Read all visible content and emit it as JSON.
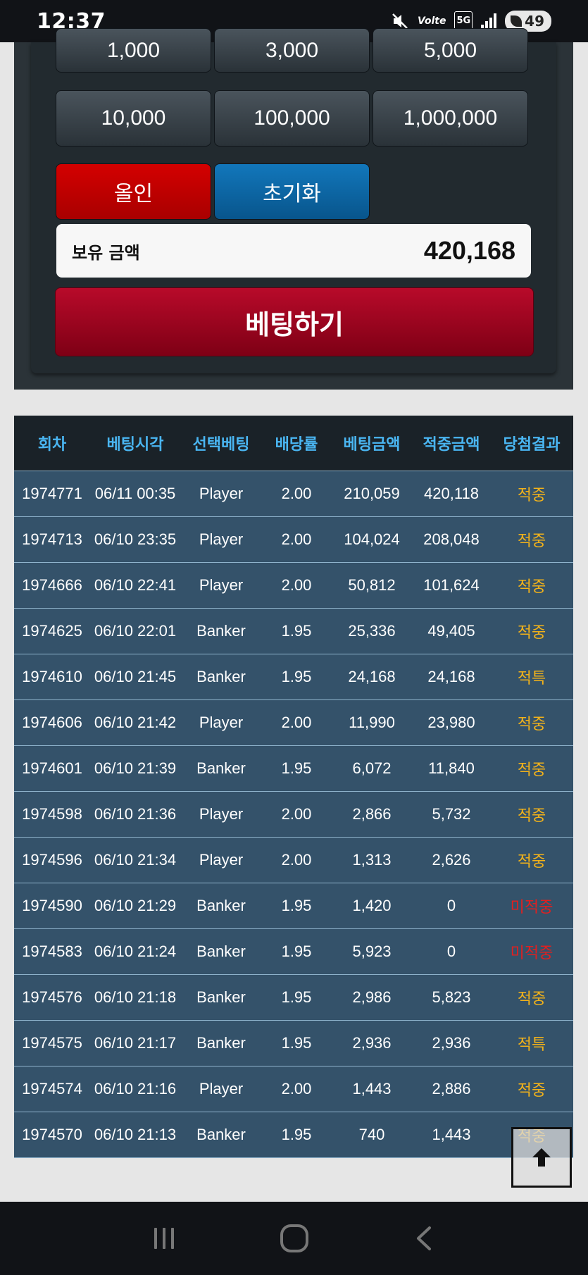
{
  "status_bar": {
    "time": "12:37",
    "battery": "49",
    "network": "5G",
    "volte": "Volte"
  },
  "amount_buttons": {
    "row1": [
      "1,000",
      "3,000",
      "5,000"
    ],
    "row2": [
      "10,000",
      "100,000",
      "1,000,000"
    ]
  },
  "actions": {
    "allin_label": "올인",
    "reset_label": "초기화"
  },
  "balance": {
    "label": "보유 금액",
    "value": "420,168"
  },
  "bet_button_label": "베팅하기",
  "history": {
    "columns": [
      "회차",
      "베팅시각",
      "선택베팅",
      "배당률",
      "베팅금액",
      "적중금액",
      "당첨결과"
    ],
    "rows": [
      [
        "1974771",
        "06/11 00:35",
        "Player",
        "2.00",
        "210,059",
        "420,118",
        "적중"
      ],
      [
        "1974713",
        "06/10 23:35",
        "Player",
        "2.00",
        "104,024",
        "208,048",
        "적중"
      ],
      [
        "1974666",
        "06/10 22:41",
        "Player",
        "2.00",
        "50,812",
        "101,624",
        "적중"
      ],
      [
        "1974625",
        "06/10 22:01",
        "Banker",
        "1.95",
        "25,336",
        "49,405",
        "적중"
      ],
      [
        "1974610",
        "06/10 21:45",
        "Banker",
        "1.95",
        "24,168",
        "24,168",
        "적특"
      ],
      [
        "1974606",
        "06/10 21:42",
        "Player",
        "2.00",
        "11,990",
        "23,980",
        "적중"
      ],
      [
        "1974601",
        "06/10 21:39",
        "Banker",
        "1.95",
        "6,072",
        "11,840",
        "적중"
      ],
      [
        "1974598",
        "06/10 21:36",
        "Player",
        "2.00",
        "2,866",
        "5,732",
        "적중"
      ],
      [
        "1974596",
        "06/10 21:34",
        "Player",
        "2.00",
        "1,313",
        "2,626",
        "적중"
      ],
      [
        "1974590",
        "06/10 21:29",
        "Banker",
        "1.95",
        "1,420",
        "0",
        "미적중"
      ],
      [
        "1974583",
        "06/10 21:24",
        "Banker",
        "1.95",
        "5,923",
        "0",
        "미적중"
      ],
      [
        "1974576",
        "06/10 21:18",
        "Banker",
        "1.95",
        "2,986",
        "5,823",
        "적중"
      ],
      [
        "1974575",
        "06/10 21:17",
        "Banker",
        "1.95",
        "2,936",
        "2,936",
        "적특"
      ],
      [
        "1974574",
        "06/10 21:16",
        "Player",
        "2.00",
        "1,443",
        "2,886",
        "적중"
      ],
      [
        "1974570",
        "06/10 21:13",
        "Banker",
        "1.95",
        "740",
        "1,443",
        "적중"
      ]
    ]
  },
  "colors": {
    "header_text": "#4ab6f2",
    "row_bg": "#34526a",
    "win": "#f2b21a",
    "lose": "#e02020"
  },
  "icons": {
    "scroll_top": "arrow-up-icon",
    "nav": [
      "recent-apps-icon",
      "home-icon",
      "back-icon"
    ]
  }
}
